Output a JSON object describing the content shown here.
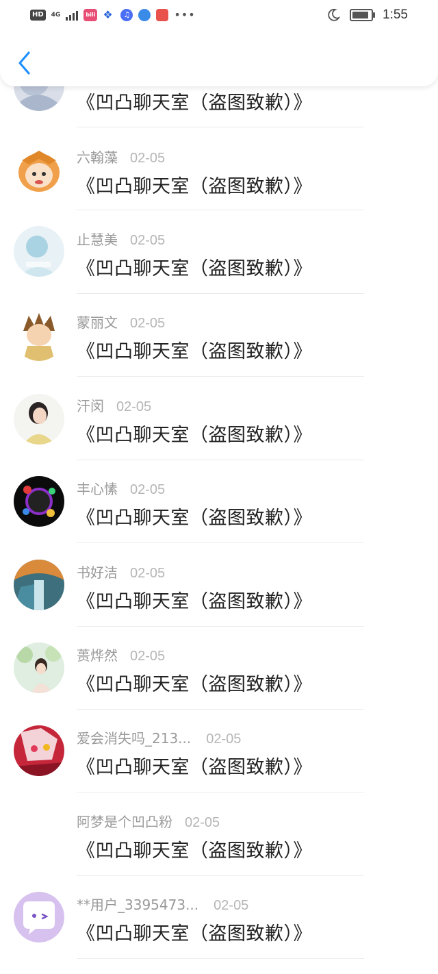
{
  "status_bar": {
    "hd": "HD",
    "network": "4G",
    "bili": "bili",
    "time": "1:55",
    "battery_level": 0.9,
    "icons": [
      "hd-icon",
      "signal-icon",
      "bilibili-icon",
      "baidu-paw-icon",
      "music-icon",
      "browser-icon",
      "app-red-icon",
      "more-dots-icon",
      "moon-icon",
      "battery-icon"
    ]
  },
  "header": {
    "back_icon": "chevron-left-icon"
  },
  "colors": {
    "accent": "#1e90ff",
    "name": "#999999",
    "date": "#b5b5b5",
    "message": "#222222",
    "divider": "#ececec"
  },
  "comments": [
    {
      "name": "",
      "date": "",
      "message": "《凹凸聊天室（盗图致歉）》"
    },
    {
      "name": "六翰藻",
      "date": "02-05",
      "message": "《凹凸聊天室（盗图致歉）》"
    },
    {
      "name": "止慧美",
      "date": "02-05",
      "message": "《凹凸聊天室（盗图致歉）》"
    },
    {
      "name": "蒙丽文",
      "date": "02-05",
      "message": "《凹凸聊天室（盗图致歉）》"
    },
    {
      "name": "汗闵",
      "date": "02-05",
      "message": "《凹凸聊天室（盗图致歉）》"
    },
    {
      "name": "丰心愫",
      "date": "02-05",
      "message": "《凹凸聊天室（盗图致歉）》"
    },
    {
      "name": "书好洁",
      "date": "02-05",
      "message": "《凹凸聊天室（盗图致歉）》"
    },
    {
      "name": "蒉烨然",
      "date": "02-05",
      "message": "《凹凸聊天室（盗图致歉）》"
    },
    {
      "name": "爱会消失吗_213...",
      "date": "02-05",
      "message": "《凹凸聊天室（盗图致歉）》"
    },
    {
      "name": "阿梦是个凹凸粉",
      "date": "02-05",
      "message": "《凹凸聊天室（盗图致歉）》"
    },
    {
      "name": "**用户_3395473...",
      "date": "02-05",
      "message": "《凹凸聊天室（盗图致歉）》"
    }
  ]
}
